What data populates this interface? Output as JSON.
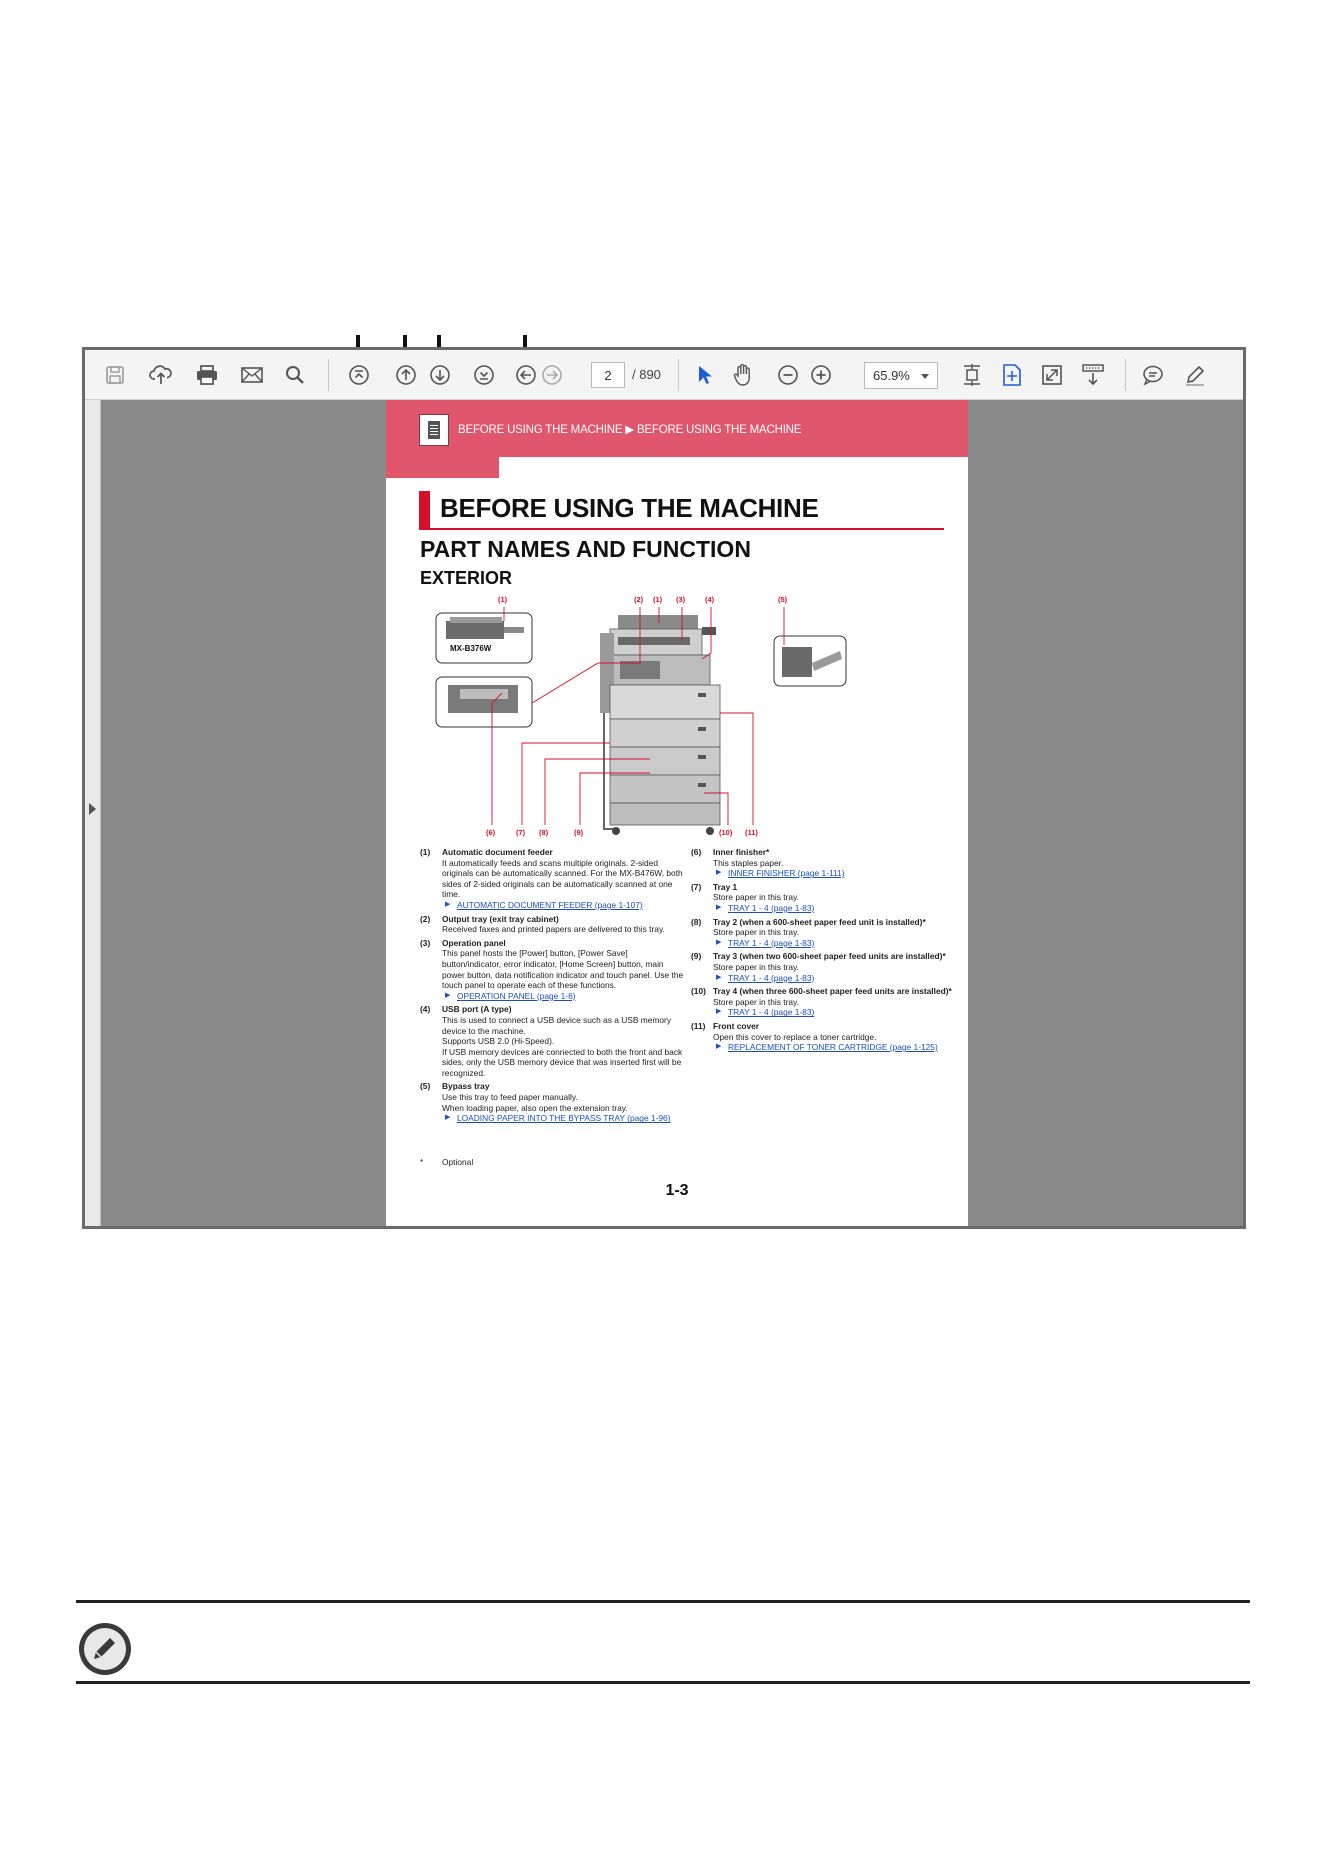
{
  "viewer": {
    "toolbar": {
      "save_icon": "save-icon",
      "upload_icon": "upload-cloud-icon",
      "print_icon": "print-icon",
      "email_icon": "email-icon",
      "search_icon": "search-icon",
      "first_page_icon": "first-page-icon",
      "previous_page_icon": "previous-page-icon",
      "next_page_icon": "next-page-icon",
      "last_page_icon": "last-page-icon",
      "previous_view_icon": "previous-view-icon",
      "next_view_icon": "next-view-icon",
      "page_value": "2",
      "page_total": "/  890",
      "zoom_value": "65.9%",
      "select_tool_icon": "cursor-icon",
      "hand_tool_icon": "hand-icon",
      "zoom_out_icon": "zoom-out-icon",
      "zoom_in_icon": "zoom-in-icon",
      "comment_icon": "comment-icon",
      "sign_icon": "pen-icon"
    },
    "colors": {
      "banner": "#e0566d",
      "accent_red": "#d4102a",
      "link": "#1b4fc2"
    }
  },
  "document": {
    "breadcrumb": "BEFORE USING THE MACHINE ▶ BEFORE USING THE MACHINE",
    "section_title": "BEFORE USING THE MACHINE",
    "heading": "PART NAMES AND FUNCTION",
    "subheading": "EXTERIOR",
    "model_label": "MX-B376W",
    "callouts_top": [
      "(1)",
      "(2)",
      "(1)",
      "(3)",
      "(4)",
      "(5)"
    ],
    "callouts_bottom": [
      "(6)",
      "(7)",
      "(8)",
      "(9)",
      "(10)",
      "(11)"
    ],
    "items_left": [
      {
        "num": "(1)",
        "title": "Automatic document feeder",
        "desc": "It automatically feeds and scans multiple originals. 2-sided originals can be automatically scanned. For the MX-B476W, both sides of 2-sided originals can be automatically scanned at one time.",
        "link": "AUTOMATIC DOCUMENT FEEDER (page 1-107)"
      },
      {
        "num": "(2)",
        "title": "Output tray (exit tray cabinet)",
        "desc": "Received faxes and printed papers are delivered to this tray.",
        "link": ""
      },
      {
        "num": "(3)",
        "title": "Operation panel",
        "desc": "This panel hosts the [Power] button, [Power Save] button/indicator, error indicator, [Home Screen] button, main power button, data notification indicator and touch panel. Use the touch panel to operate each of these functions.",
        "link": "OPERATION PANEL (page 1-6)"
      },
      {
        "num": "(4)",
        "title": "USB port (A type)",
        "desc": "This is used to connect a USB device such as a USB memory device to the machine.\nSupports USB 2.0 (Hi-Speed).\nIf USB memory devices are connected to both the front and back sides, only the USB memory device that was inserted first will be recognized.",
        "link": ""
      },
      {
        "num": "(5)",
        "title": "Bypass tray",
        "desc": "Use this tray to feed paper manually.\nWhen loading paper, also open the extension tray.",
        "link": "LOADING PAPER INTO THE BYPASS TRAY (page 1-96)"
      }
    ],
    "items_right": [
      {
        "num": "(6)",
        "title": "Inner finisher*",
        "desc": "This staples paper.",
        "link": "INNER FINISHER (page 1-111)"
      },
      {
        "num": "(7)",
        "title": "Tray 1",
        "desc": "Store paper in this tray.",
        "link": "TRAY 1 - 4 (page 1-83)"
      },
      {
        "num": "(8)",
        "title": "Tray 2 (when a 600-sheet paper feed unit is installed)*",
        "desc": "Store paper in this tray.",
        "link": "TRAY 1 - 4 (page 1-83)"
      },
      {
        "num": "(9)",
        "title": "Tray 3 (when two 600-sheet paper feed units are installed)*",
        "desc": "Store paper in this tray.",
        "link": "TRAY 1 - 4 (page 1-83)"
      },
      {
        "num": "(10)",
        "title": "Tray 4 (when three 600-sheet paper feed units are installed)*",
        "desc": "Store paper in this tray.",
        "link": "TRAY 1 - 4 (page 1-83)"
      },
      {
        "num": "(11)",
        "title": "Front cover",
        "desc": "Open this cover to replace a toner cartridge.",
        "link": "REPLACEMENT OF TONER CARTRIDGE (page 1-125)"
      }
    ],
    "footnote_mark": "*",
    "footnote_text": "Optional",
    "page_number": "1-3"
  },
  "note": {
    "icon": "pencil-note-icon"
  }
}
